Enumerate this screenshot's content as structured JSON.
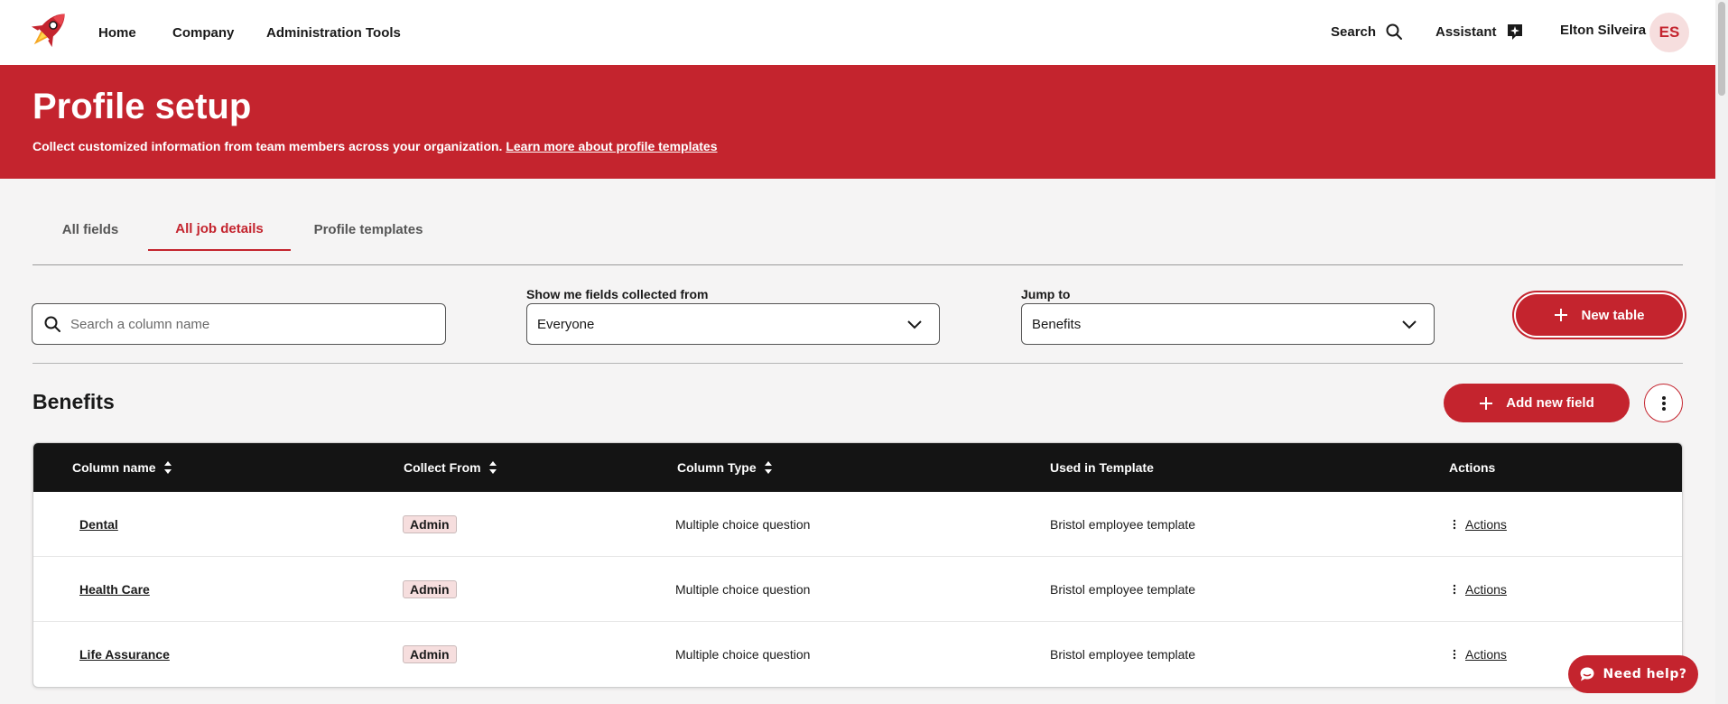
{
  "nav": {
    "links": [
      "Home",
      "Company",
      "Administration Tools"
    ],
    "search_label": "Search",
    "assistant_label": "Assistant",
    "user_name": "Elton Silveira",
    "user_initials": "ES"
  },
  "hero": {
    "title": "Profile setup",
    "description": "Collect customized information from team members across your organization.",
    "learn_more": "Learn more about profile templates",
    "background_color": "#c4242e"
  },
  "tabs": [
    {
      "label": "All fields",
      "active": false
    },
    {
      "label": "All job details",
      "active": true
    },
    {
      "label": "Profile templates",
      "active": false
    }
  ],
  "filters": {
    "search_placeholder": "Search a column name",
    "show_from_label": "Show me fields collected from",
    "show_from_value": "Everyone",
    "jump_to_label": "Jump to",
    "jump_to_value": "Benefits",
    "new_table_label": "New table"
  },
  "section": {
    "title": "Benefits",
    "add_field_label": "Add new field"
  },
  "table": {
    "headers": [
      "Column name",
      "Collect From",
      "Column Type",
      "Used in Template",
      "Actions"
    ],
    "rows": [
      {
        "name": "Dental",
        "collect_from": "Admin",
        "type": "Multiple choice question",
        "template": "Bristol employee template",
        "action": "Actions"
      },
      {
        "name": "Health Care",
        "collect_from": "Admin",
        "type": "Multiple choice question",
        "template": "Bristol employee template",
        "action": "Actions"
      },
      {
        "name": "Life Assurance",
        "collect_from": "Admin",
        "type": "Multiple choice question",
        "template": "Bristol employee template",
        "action": "Actions"
      }
    ]
  },
  "help": {
    "label": "Need help?"
  },
  "icons": {
    "logo": "rocket-logo",
    "search": "search-icon",
    "assistant": "assistant-sparkle-icon",
    "sort": "sort-icon",
    "chevron": "chevron-down-icon",
    "plus": "plus-icon",
    "kebab": "kebab-icon",
    "chat": "chat-bubble-icon"
  },
  "colors": {
    "brand_red": "#c4242e",
    "table_header": "#141414",
    "badge_bg": "#f6dede",
    "page_bg": "#f5f4f4"
  }
}
